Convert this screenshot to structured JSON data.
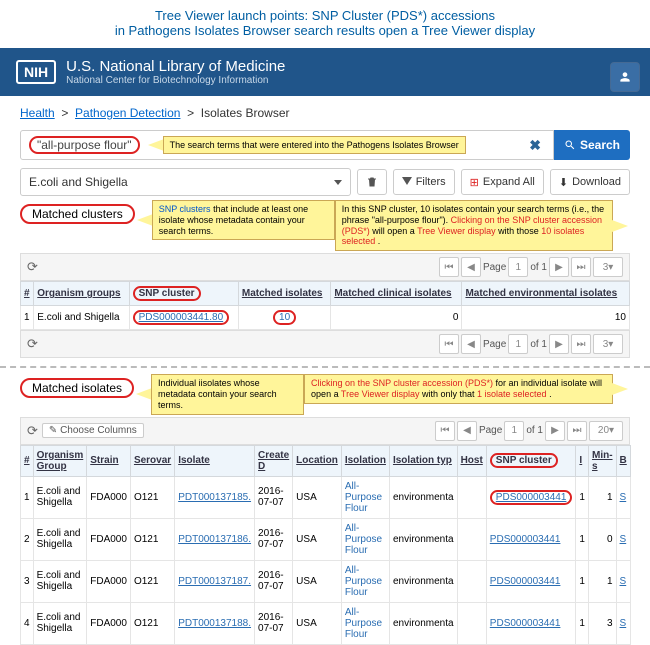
{
  "title_line1": "Tree Viewer launch points:  SNP Cluster (PDS*) accessions",
  "title_line2": "in Pathogens Isolates Browser search results open a Tree Viewer display",
  "nih": {
    "logo": "NIH",
    "line1": "U.S. National Library of Medicine",
    "line2": "National Center for Biotechnology Information"
  },
  "breadcrumbs": {
    "a": "Health",
    "b": "Pathogen Detection",
    "c": "Isolates Browser"
  },
  "search": {
    "value": "\"all-purpose flour\"",
    "btn": "Search",
    "callout": "The search terms that were entered into the Pathogens Isolates Browser"
  },
  "filters": {
    "selected": "E.coli and Shigella",
    "filter_btn": "Filters",
    "expand_btn": "Expand All",
    "download_btn": "Download"
  },
  "matched_clusters_label": "Matched clusters",
  "clusters_callout1_a": "SNP clusters",
  "clusters_callout1_b": " that include at least one isolate whose metadata contain your search terms.",
  "clusters_callout2_a": "In this SNP cluster, 10 isolates contain your search terms (i.e., the phrase \"all-purpose flour\"). ",
  "clusters_callout2_b": "Clicking on the SNP cluster accession (PDS*)",
  "clusters_callout2_c": " will open a ",
  "clusters_callout2_d": "Tree Viewer display",
  "clusters_callout2_e": " with those ",
  "clusters_callout2_f": "10 isolates selected",
  "clusters_callout2_g": ".",
  "pager": {
    "page_lbl": "Page",
    "page_num": "1",
    "of": "of 1",
    "size": "3"
  },
  "clusters_table": {
    "headers": [
      "#",
      "Organism groups",
      "SNP cluster",
      "Matched isolates",
      "Matched clinical isolates",
      "Matched environmental isolates"
    ],
    "row": {
      "num": "1",
      "org": "E.coli and Shigella",
      "snp": "PDS000003441.80",
      "matched": "10",
      "clinical": "0",
      "env": "10"
    }
  },
  "matched_isolates_label": "Matched isolates",
  "iso_callout1": "Individual iisolates whose metadata contain your search terms.",
  "iso_callout2_a": "Clicking on the SNP cluster accession (PDS*)",
  "iso_callout2_b": " for an individual isolate will open a ",
  "iso_callout2_c": "Tree Viewer display",
  "iso_callout2_d": " with only that ",
  "iso_callout2_e": "1 isolate selected",
  "iso_callout2_f": ".",
  "choose_cols": "Choose Columns",
  "pager2": {
    "page_num": "1",
    "of": "of 1",
    "size": "20"
  },
  "iso_headers": [
    "#",
    "Organism Group",
    "Strain",
    "Serovar",
    "Isolate",
    "Create D",
    "Location",
    "Isolation",
    "Isolation typ",
    "Host",
    "SNP cluster",
    "I",
    "Min-s",
    "B"
  ],
  "iso_rows": [
    {
      "n": "1",
      "org": "E.coli and Shigella",
      "strain": "FDA000",
      "sero": "O121",
      "iso": "PDT000137185.",
      "date": "2016-07-07",
      "loc": "USA",
      "src": "All-Purpose Flour",
      "typ": "environmenta",
      "host": "",
      "snp": "PDS000003441",
      "i": "1",
      "min": "1",
      "b": "S"
    },
    {
      "n": "2",
      "org": "E.coli and Shigella",
      "strain": "FDA000",
      "sero": "O121",
      "iso": "PDT000137186.",
      "date": "2016-07-07",
      "loc": "USA",
      "src": "All-Purpose Flour",
      "typ": "environmenta",
      "host": "",
      "snp": "PDS000003441",
      "i": "1",
      "min": "0",
      "b": "S"
    },
    {
      "n": "3",
      "org": "E.coli and Shigella",
      "strain": "FDA000",
      "sero": "O121",
      "iso": "PDT000137187.",
      "date": "2016-07-07",
      "loc": "USA",
      "src": "All-Purpose Flour",
      "typ": "environmenta",
      "host": "",
      "snp": "PDS000003441",
      "i": "1",
      "min": "1",
      "b": "S"
    },
    {
      "n": "4",
      "org": "E.coli and Shigella",
      "strain": "FDA000",
      "sero": "O121",
      "iso": "PDT000137188.",
      "date": "2016-07-07",
      "loc": "USA",
      "src": "All-Purpose Flour",
      "typ": "environmenta",
      "host": "",
      "snp": "PDS000003441",
      "i": "1",
      "min": "3",
      "b": "S"
    }
  ]
}
